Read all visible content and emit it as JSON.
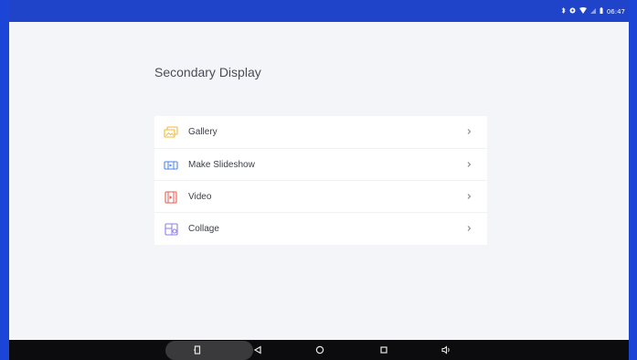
{
  "status_bar": {
    "icons": [
      "bluetooth-icon",
      "circle-icon",
      "wifi-icon",
      "no-sim-icon",
      "battery-icon"
    ],
    "clock": "06:47"
  },
  "page": {
    "title": "Secondary Display"
  },
  "menu": {
    "items": [
      {
        "label": "Gallery",
        "icon": "gallery-icon",
        "color": "#f5b731"
      },
      {
        "label": "Make Slideshow",
        "icon": "slideshow-icon",
        "color": "#4a86f0"
      },
      {
        "label": "Video",
        "icon": "video-icon",
        "color": "#ee5a4f"
      },
      {
        "label": "Collage",
        "icon": "collage-icon",
        "color": "#8f7ee8"
      }
    ]
  },
  "nav_bar": {
    "buttons": [
      "screenshot-icon",
      "back-icon",
      "home-icon",
      "recents-icon",
      "volume-icon"
    ]
  }
}
